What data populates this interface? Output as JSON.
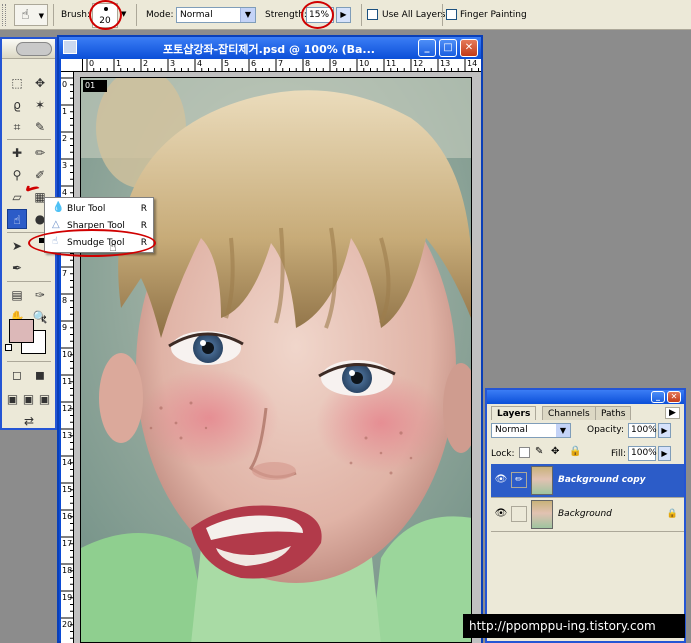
{
  "options_bar": {
    "brush_label": "Brush:",
    "brush_size": "20",
    "mode_label": "Mode:",
    "mode_value": "Normal",
    "strength_label": "Strength:",
    "strength_value": "15%",
    "use_all_layers_label": "Use All Layers",
    "finger_painting_label": "Finger Painting"
  },
  "flyout_menu": {
    "items": [
      {
        "label": "Blur Tool",
        "shortcut": "R",
        "icon": "blur-drop-icon"
      },
      {
        "label": "Sharpen Tool",
        "shortcut": "R",
        "icon": "sharpen-triangle-icon"
      },
      {
        "label": "Smudge Tool",
        "shortcut": "R",
        "icon": "smudge-finger-icon"
      }
    ]
  },
  "document": {
    "title": "포토샵강좌-잡티제거.psd @ 100% (Ba...",
    "ruler_h": [
      "0",
      "1",
      "2",
      "3",
      "4",
      "5",
      "6",
      "7",
      "8",
      "9",
      "10",
      "11",
      "12",
      "13",
      "14"
    ],
    "ruler_v": [
      "0",
      "1",
      "2",
      "3",
      "4",
      "5",
      "6",
      "7",
      "8",
      "9",
      "10",
      "11",
      "12",
      "13",
      "14",
      "15",
      "16",
      "17",
      "18",
      "19",
      "20"
    ],
    "photo_tag": "01"
  },
  "layers_panel": {
    "tabs": [
      "Layers",
      "Channels",
      "Paths"
    ],
    "blend_mode": "Normal",
    "opacity_label": "Opacity:",
    "opacity_value": "100%",
    "lock_label": "Lock:",
    "fill_label": "Fill:",
    "fill_value": "100%",
    "layers": [
      {
        "name": "Background copy",
        "selected": true
      },
      {
        "name": "Background",
        "selected": false
      }
    ]
  },
  "watermark": "http://ppomppu-ing.tistory.com",
  "colors": {
    "xp_blue": "#0a4ad4",
    "chrome": "#ece9d8",
    "foreground_swatch": "#dcb8b8",
    "background_swatch": "#ffffff",
    "highlight": "#d00000"
  }
}
